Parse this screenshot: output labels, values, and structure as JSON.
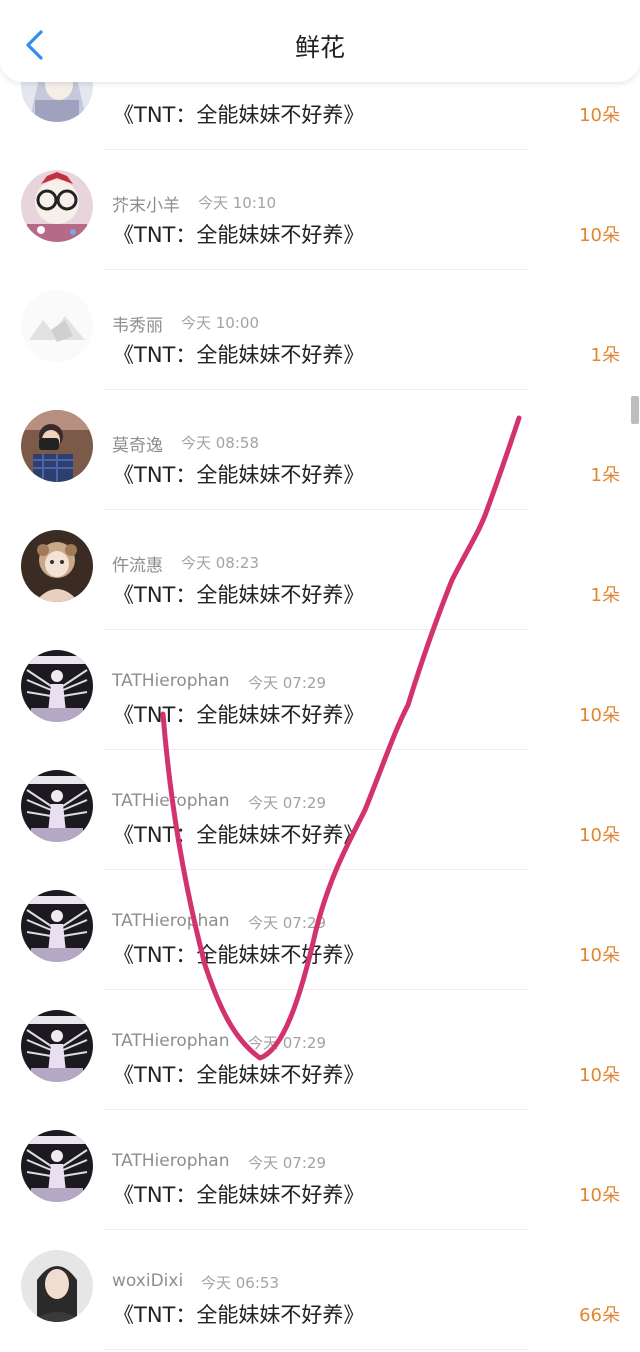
{
  "header": {
    "title": "鲜花",
    "back_icon": "chevron-left-icon",
    "accent_color": "#2e8ef0"
  },
  "rows": [
    {
      "name": "",
      "time": "",
      "book": "《TNT：全能妹妹不好养》",
      "count": "10朵",
      "avatar": "anime-character"
    },
    {
      "name": "芥末小羊",
      "time": "今天 10:10",
      "book": "《TNT：全能妹妹不好养》",
      "count": "10朵",
      "avatar": "glasses-cartoon"
    },
    {
      "name": "韦秀丽",
      "time": "今天 10:00",
      "book": "《TNT：全能妹妹不好养》",
      "count": "1朵",
      "avatar": "faded-landscape"
    },
    {
      "name": "莫奇逸",
      "time": "今天 08:58",
      "book": "《TNT：全能妹妹不好养》",
      "count": "1朵",
      "avatar": "person-camera"
    },
    {
      "name": "仵流惠",
      "time": "今天 08:23",
      "book": "《TNT：全能妹妹不好养》",
      "count": "1朵",
      "avatar": "doll-portrait"
    },
    {
      "name": "TATHierophan",
      "time": "今天 07:29",
      "book": "《TNT：全能妹妹不好养》",
      "count": "10朵",
      "avatar": "stage-figure"
    },
    {
      "name": "TATHierophan",
      "time": "今天 07:29",
      "book": "《TNT：全能妹妹不好养》",
      "count": "10朵",
      "avatar": "stage-figure"
    },
    {
      "name": "TATHierophan",
      "time": "今天 07:29",
      "book": "《TNT：全能妹妹不好养》",
      "count": "10朵",
      "avatar": "stage-figure"
    },
    {
      "name": "TATHierophan",
      "time": "今天 07:29",
      "book": "《TNT：全能妹妹不好养》",
      "count": "10朵",
      "avatar": "stage-figure"
    },
    {
      "name": "TATHierophan",
      "time": "今天 07:29",
      "book": "《TNT：全能妹妹不好养》",
      "count": "10朵",
      "avatar": "stage-figure"
    },
    {
      "name": "woxiDixi",
      "time": "今天 06:53",
      "book": "《TNT：全能妹妹不好养》",
      "count": "66朵",
      "avatar": "girl-portrait"
    }
  ],
  "colors": {
    "count": "#e2852f",
    "annotation": "#d2336f"
  }
}
